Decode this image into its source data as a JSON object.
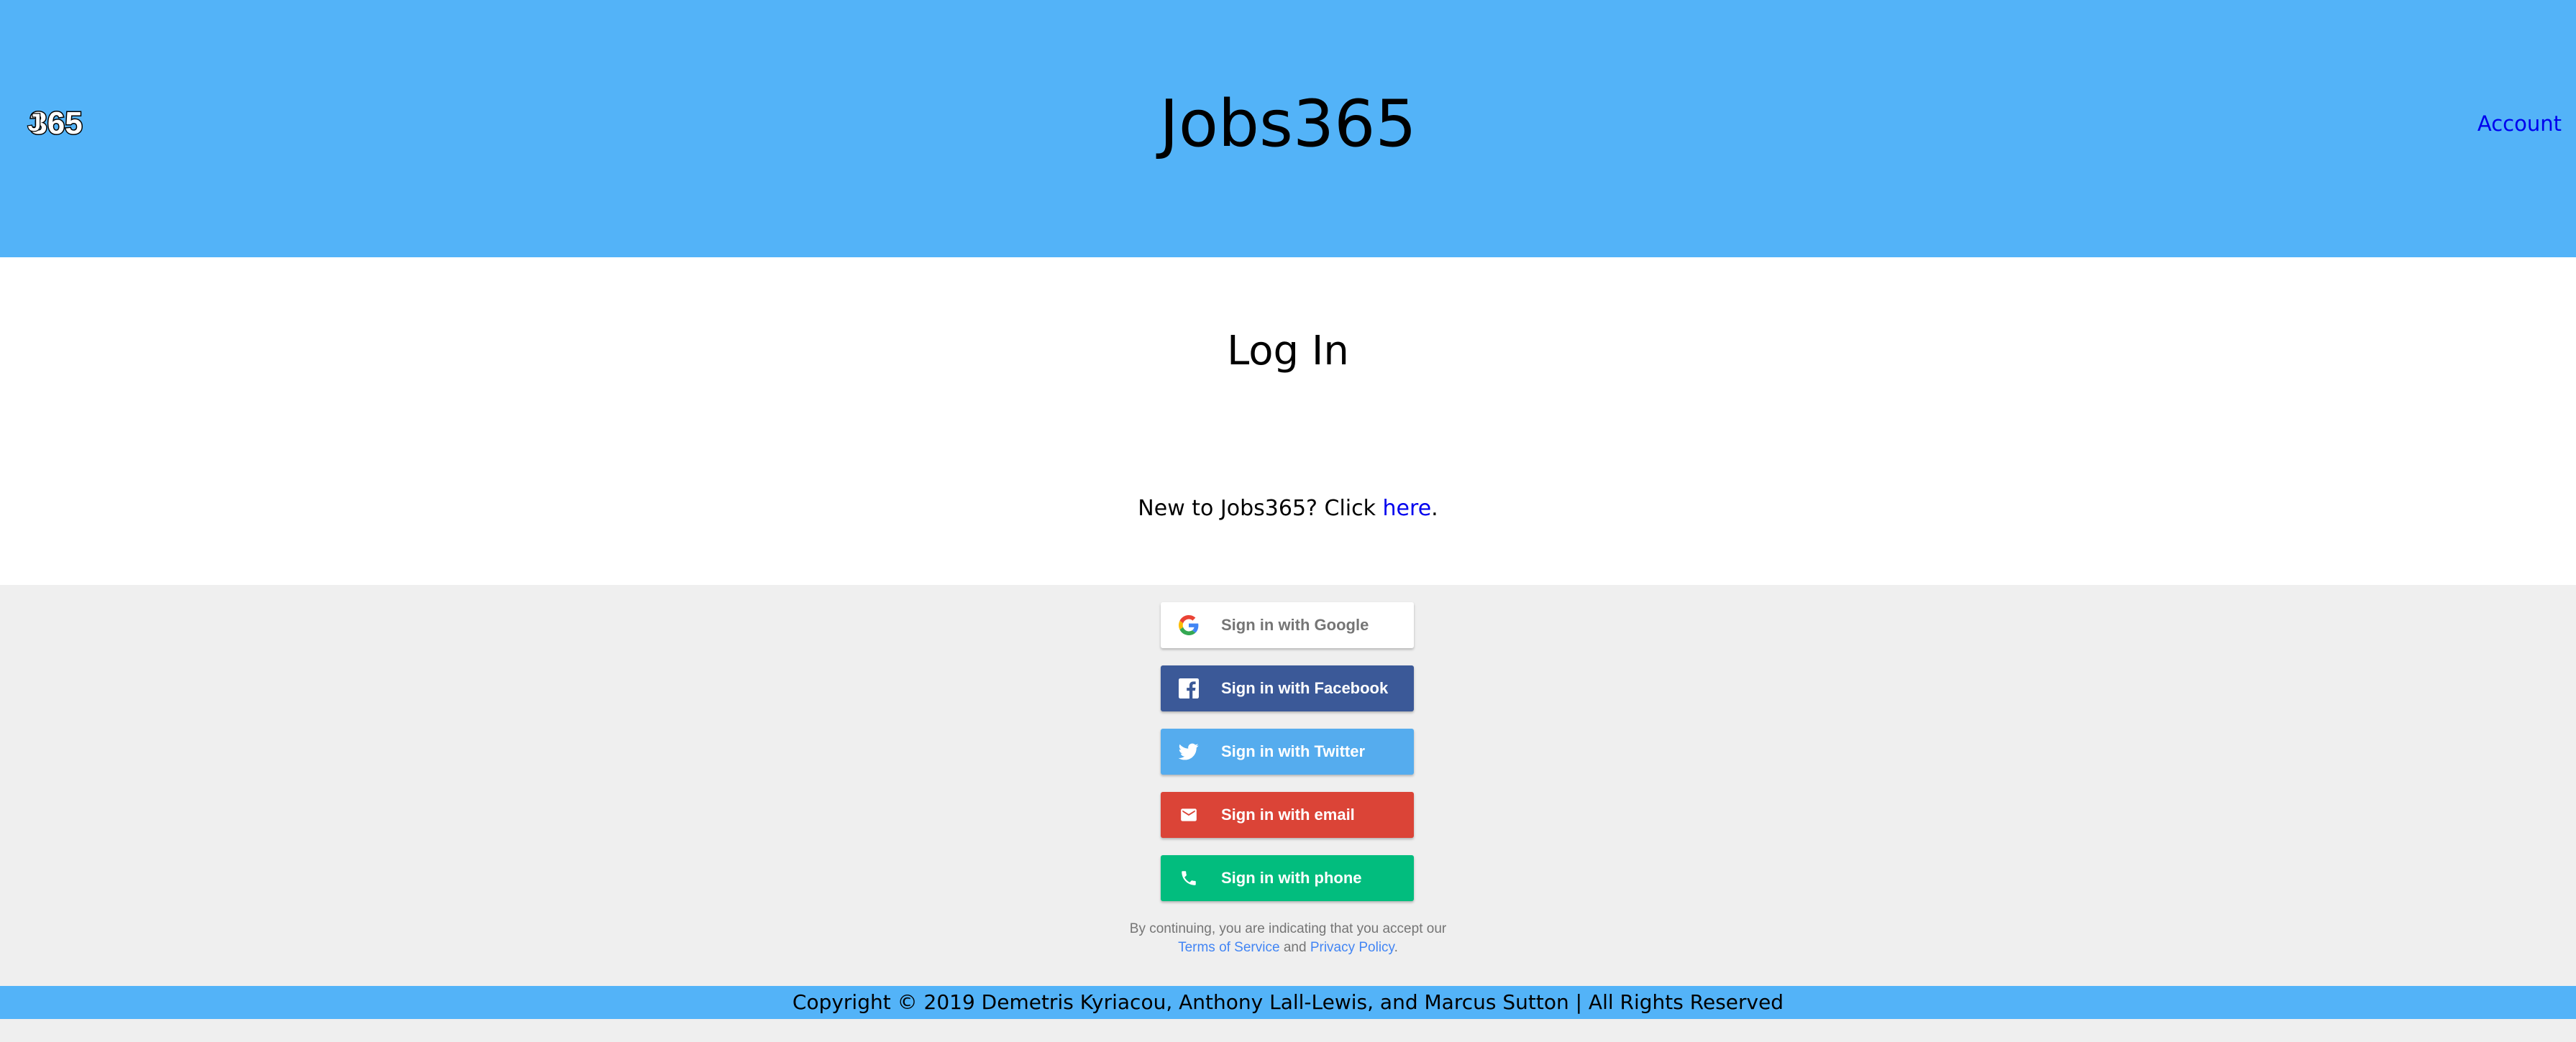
{
  "header": {
    "logo_text": "J365",
    "title": "Jobs365",
    "account_label": "Account"
  },
  "main": {
    "title": "Log In",
    "new_user_prefix": "New to Jobs365? Click ",
    "new_user_link": "here",
    "new_user_suffix": "."
  },
  "auth": {
    "buttons": [
      {
        "label": "Sign in with Google",
        "icon": "google-icon"
      },
      {
        "label": "Sign in with Facebook",
        "icon": "facebook-icon"
      },
      {
        "label": "Sign in with Twitter",
        "icon": "twitter-icon"
      },
      {
        "label": "Sign in with email",
        "icon": "mail-icon"
      },
      {
        "label": "Sign in with phone",
        "icon": "phone-icon"
      }
    ],
    "tos_prefix": "By continuing, you are indicating that you accept our",
    "tos_link": "Terms of Service",
    "tos_and": " and ",
    "privacy_link": "Privacy Policy",
    "tos_suffix": "."
  },
  "footer": {
    "copyright": "Copyright © 2019 Demetris Kyriacou, Anthony Lall-Lewis, and Marcus Sutton | All Rights Reserved"
  },
  "colors": {
    "header_bg": "#53b3f8",
    "google": "#ffffff",
    "facebook": "#3b5998",
    "twitter": "#55acee",
    "email": "#db4437",
    "phone": "#02bd7e"
  }
}
